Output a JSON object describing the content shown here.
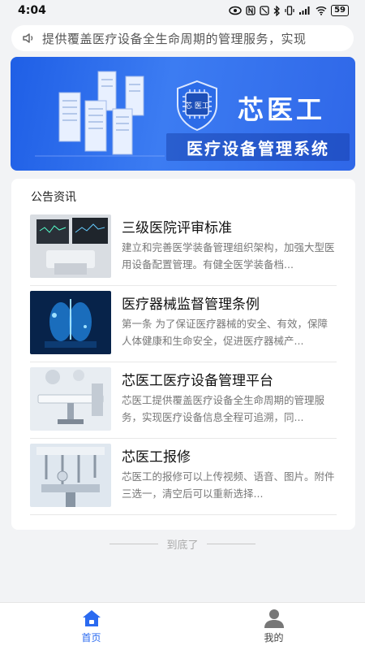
{
  "status": {
    "time": "4:04",
    "battery": "59"
  },
  "notice": {
    "text": "提供覆盖医疗设备全生命周期的管理服务，实现"
  },
  "banner": {
    "brand": "芯医工",
    "chip_text": "芯 医工",
    "subtitle": "医疗设备管理系统"
  },
  "section": {
    "title": "公告资讯"
  },
  "news": [
    {
      "title": "三级医院评审标准",
      "desc": "建立和完善医学装备管理组织架构，加强大型医用设备配置管理。有健全医学装备档..."
    },
    {
      "title": "医疗器械监督管理条例",
      "desc": "第一条 为了保证医疗器械的安全、有效，保障人体健康和生命安全，促进医疗器械产..."
    },
    {
      "title": "芯医工医疗设备管理平台",
      "desc": "芯医工提供覆盖医疗设备全生命周期的管理服务，实现医疗设备信息全程可追溯，同..."
    },
    {
      "title": "芯医工报修",
      "desc": "芯医工的报修可以上传视频、语音、图片。附件三选一，清空后可以重新选择..."
    }
  ],
  "footer": {
    "end_text": "到底了"
  },
  "tabs": [
    {
      "label": "首页",
      "icon": "home-icon",
      "active": true
    },
    {
      "label": "我的",
      "icon": "user-icon",
      "active": false
    }
  ],
  "colors": {
    "accent": "#2a6af0",
    "banner": "#2f67e8"
  }
}
